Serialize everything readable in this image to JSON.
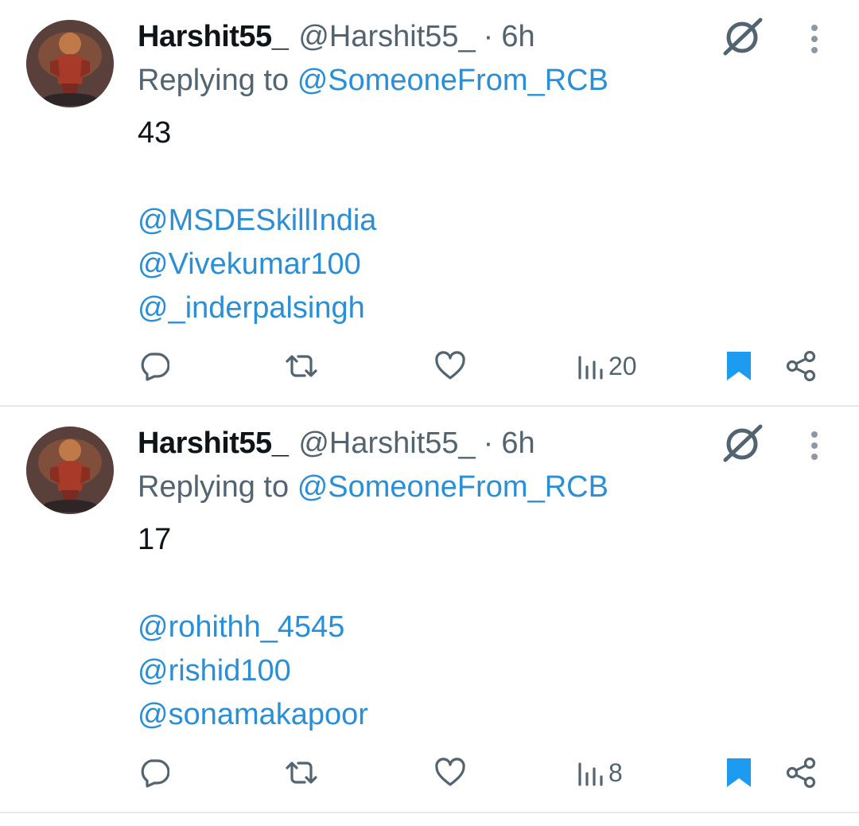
{
  "tweets": [
    {
      "display_name": "Harshit55_",
      "handle": "@Harshit55_",
      "separator": "·",
      "time": "6h",
      "replying_prefix": "Replying to",
      "replying_to": "@SomeoneFrom_RCB",
      "text": "43",
      "mentions": [
        "@MSDESkillIndia",
        "@Vivekumar100",
        "@_inderpalsingh"
      ],
      "views": "20",
      "icons": [
        "reply-icon",
        "retweet-icon",
        "like-icon",
        "views-icon",
        "bookmark-icon",
        "share-icon",
        "grok-icon",
        "more-icon"
      ]
    },
    {
      "display_name": "Harshit55_",
      "handle": "@Harshit55_",
      "separator": "·",
      "time": "6h",
      "replying_prefix": "Replying to",
      "replying_to": "@SomeoneFrom_RCB",
      "text": "17",
      "mentions": [
        "@rohithh_4545",
        "@rishid100",
        "@sonamakapoor"
      ],
      "views": "8",
      "icons": [
        "reply-icon",
        "retweet-icon",
        "like-icon",
        "views-icon",
        "bookmark-icon",
        "share-icon",
        "grok-icon",
        "more-icon"
      ]
    }
  ],
  "colors": {
    "text": "#0f1419",
    "secondary": "#536471",
    "link": "#2a8fd6",
    "bookmark": "#1d9bf0",
    "divider": "#e6e9ec"
  }
}
